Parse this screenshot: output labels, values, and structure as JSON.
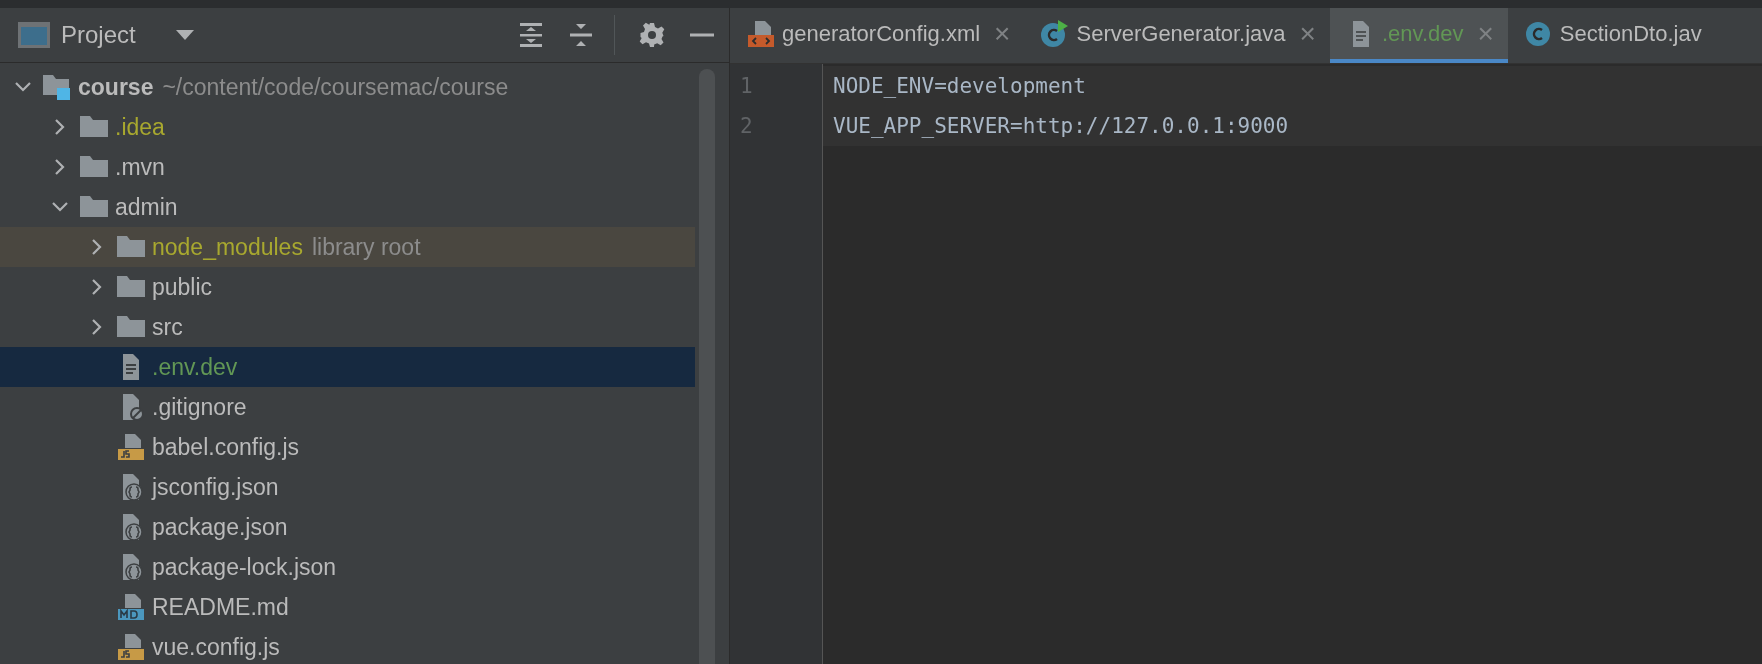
{
  "project_panel": {
    "title": "Project",
    "tree": [
      {
        "name": "course",
        "path": "~/content/code/coursemac/course",
        "kind": "module",
        "expanded": true,
        "selected": false,
        "children": [
          {
            "name": ".idea",
            "kind": "folder",
            "color": "#a8a82f",
            "expanded": false,
            "selected": false
          },
          {
            "name": ".mvn",
            "kind": "folder",
            "color": "#bbbbbb",
            "expanded": false,
            "selected": false
          },
          {
            "name": "admin",
            "kind": "folder",
            "color": "#bbbbbb",
            "expanded": true,
            "selected": false,
            "children": [
              {
                "name": "node_modules",
                "hint": "library root",
                "kind": "folder",
                "color": "#a8a82f",
                "expanded": false,
                "selected": false
              },
              {
                "name": "public",
                "kind": "folder",
                "color": "#bbbbbb",
                "expanded": false,
                "selected": false
              },
              {
                "name": "src",
                "kind": "folder",
                "color": "#bbbbbb",
                "expanded": false,
                "selected": false
              },
              {
                "name": ".env.dev",
                "kind": "text",
                "color": "#629755",
                "selected": true
              },
              {
                "name": ".gitignore",
                "kind": "ignore",
                "color": "#bbbbbb",
                "selected": false
              },
              {
                "name": "babel.config.js",
                "kind": "js",
                "color": "#bbbbbb",
                "selected": false
              },
              {
                "name": "jsconfig.json",
                "kind": "json",
                "color": "#bbbbbb",
                "selected": false
              },
              {
                "name": "package.json",
                "kind": "json",
                "color": "#bbbbbb",
                "selected": false
              },
              {
                "name": "package-lock.json",
                "kind": "json",
                "color": "#bbbbbb",
                "selected": false
              },
              {
                "name": "README.md",
                "kind": "md",
                "color": "#bbbbbb",
                "selected": false
              },
              {
                "name": "vue.config.js",
                "kind": "js",
                "color": "#bbbbbb",
                "selected": false
              }
            ]
          }
        ]
      }
    ]
  },
  "editor": {
    "tabs": [
      {
        "label": "generatorConfig.xml",
        "kind": "xml",
        "color": "#bbbbbb",
        "selected": false,
        "close": "×"
      },
      {
        "label": "ServerGenerator.java",
        "kind": "runclass",
        "color": "#bbbbbb",
        "selected": false,
        "close": "×"
      },
      {
        "label": ".env.dev",
        "kind": "text",
        "color": "#629755",
        "selected": true,
        "close": "×"
      },
      {
        "label": "SectionDto.jav",
        "kind": "class",
        "color": "#bbbbbb",
        "selected": false
      }
    ],
    "lines": [
      {
        "number": "1",
        "text": "NODE_ENV=development"
      },
      {
        "number": "2",
        "text": "VUE_APP_SERVER=http://127.0.0.1:9000"
      }
    ]
  }
}
